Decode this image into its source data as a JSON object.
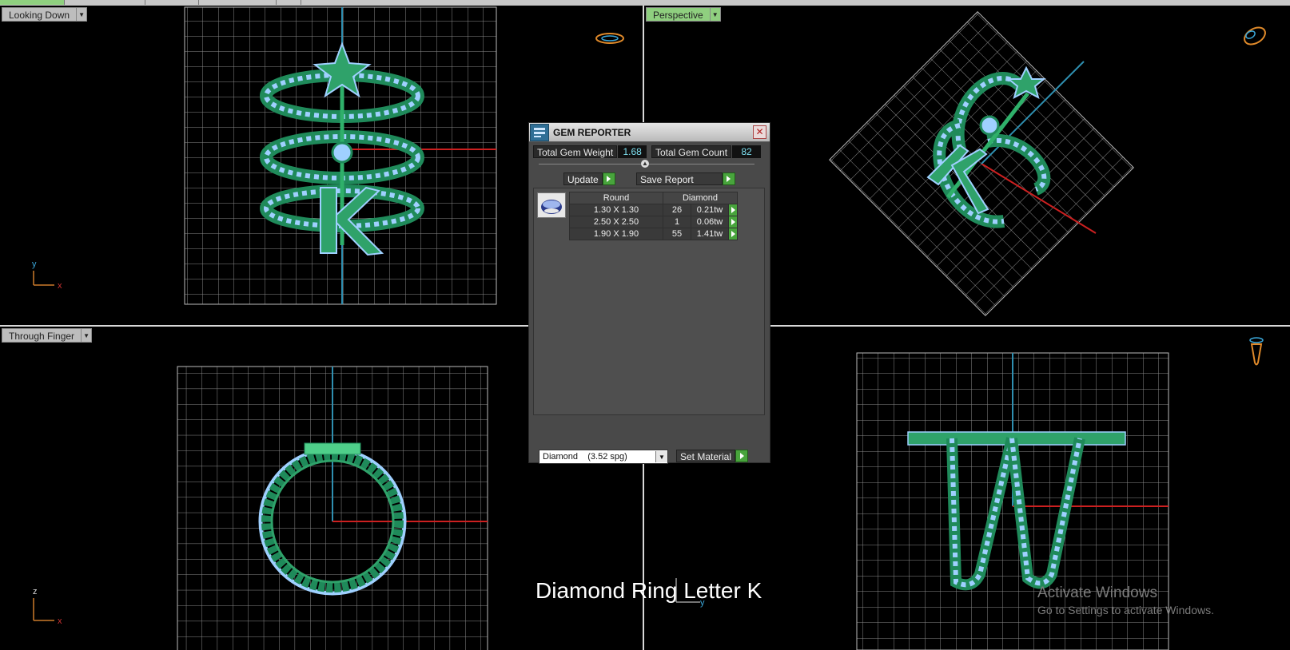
{
  "viewports": {
    "top_left": {
      "label": "Looking Down",
      "axis_h": "x",
      "axis_v": "y"
    },
    "top_right": {
      "label": "Perspective"
    },
    "bottom_left": {
      "label": "Through Finger",
      "axis_h": "x",
      "axis_v": "z"
    },
    "bottom_right": {
      "axis_h": "y"
    }
  },
  "gem_reporter": {
    "title": "GEM REPORTER",
    "total_weight_label": "Total Gem Weight",
    "total_weight_value": "1.68",
    "total_count_label": "Total Gem Count",
    "total_count_value": "82",
    "update_label": "Update",
    "save_report_label": "Save Report",
    "table": {
      "header_shape": "Round",
      "header_material": "Diamond",
      "rows": [
        {
          "size": "1.30 X 1.30",
          "count": "26",
          "weight": "0.21tw"
        },
        {
          "size": "2.50 X 2.50",
          "count": "1",
          "weight": "0.06tw"
        },
        {
          "size": "1.90 X 1.90",
          "count": "55",
          "weight": "1.41tw"
        }
      ]
    },
    "material_select_value": "Diamond    (3.52 spg)",
    "set_material_label": "Set Material"
  },
  "caption": "Diamond Ring Letter K",
  "watermark": {
    "line1": "Activate Windows",
    "line2": "Go to Settings to activate Windows."
  },
  "colors": {
    "gem": "#9fd0ff",
    "metal": "#1f8a5a",
    "grid": "#9a9a9a",
    "axis_red": "#cc2020",
    "axis_blue": "#2f8fb0"
  }
}
